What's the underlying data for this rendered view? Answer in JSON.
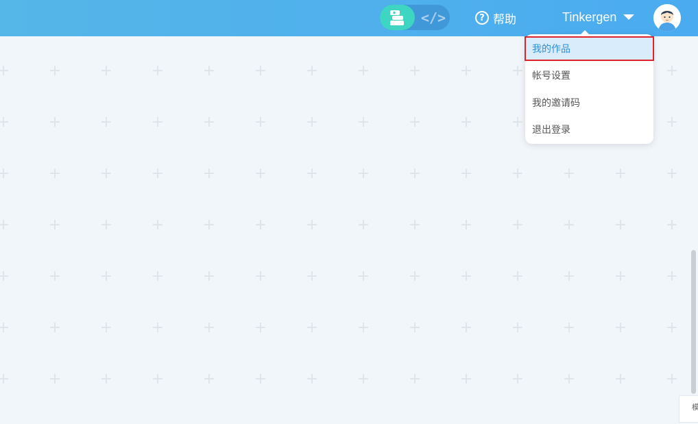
{
  "header": {
    "mode_toggle": {
      "block_mode": "blocks-icon",
      "code_mode_symbol": "</>"
    },
    "help_label": "帮助",
    "help_icon": "?",
    "username": "Tinkergen",
    "avatar": "boy-avatar-icon"
  },
  "user_dropdown": {
    "items": [
      {
        "label": "我的作品",
        "selected": true
      },
      {
        "label": "帐号设置",
        "selected": false
      },
      {
        "label": "我的邀请码",
        "selected": false
      },
      {
        "label": "退出登录",
        "selected": false
      }
    ]
  },
  "corner_panel": {
    "label": "模"
  },
  "colors": {
    "header_gradient_start": "#55b6e8",
    "header_gradient_end": "#4aabf0",
    "block_mode_active": "#3ed6c3",
    "canvas_bg": "#f1f6fb",
    "selected_item_bg": "#d8ecfb",
    "selected_item_text": "#2f8ed9",
    "highlight_border": "#e0212a"
  }
}
